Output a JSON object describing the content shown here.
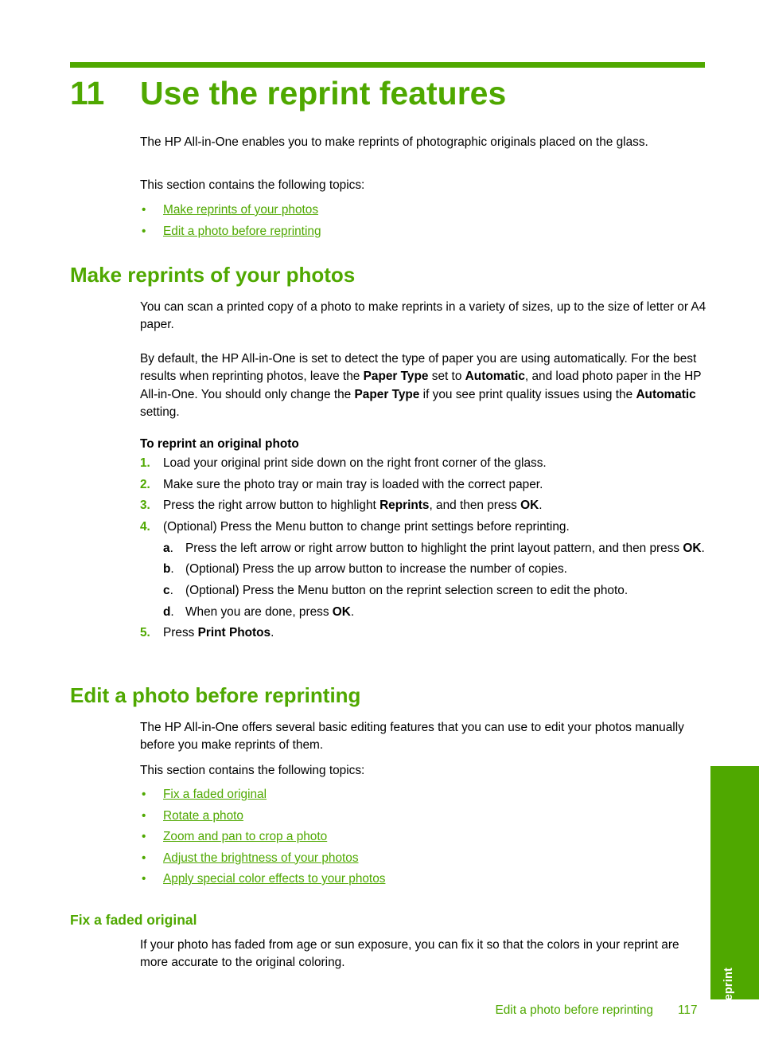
{
  "colors": {
    "accent_green": "#4FA800",
    "text_black": "#000000",
    "tab_text": "#FFFFFF"
  },
  "chapter": {
    "number": "11",
    "title": "Use the reprint features"
  },
  "intro": {
    "paragraph": "The HP All-in-One enables you to make reprints of photographic originals placed on the glass.",
    "topics_lead": "This section contains the following topics:",
    "bullet": "•",
    "topics": [
      {
        "label": "Make reprints of your photos"
      },
      {
        "label": "Edit a photo before reprinting"
      }
    ]
  },
  "section_make_reprints": {
    "heading": "Make reprints of your photos",
    "paragraph_1": "You can scan a printed copy of a photo to make reprints in a variety of sizes, up to the size of letter or A4 paper.",
    "paragraph_2_parts": [
      {
        "text": "By default, the HP All-in-One is set to detect the type of paper you are using automatically. For the best results when reprinting photos, leave the ",
        "bold": false
      },
      {
        "text": "Paper Type",
        "bold": true
      },
      {
        "text": " set to ",
        "bold": false
      },
      {
        "text": "Automatic",
        "bold": true
      },
      {
        "text": ", and load photo paper in the HP All-in-One. You should only change the ",
        "bold": false
      },
      {
        "text": "Paper Type",
        "bold": true
      },
      {
        "text": " if you see print quality issues using the ",
        "bold": false
      },
      {
        "text": "Automatic",
        "bold": true
      },
      {
        "text": " setting.",
        "bold": false
      }
    ],
    "procedure_title": "To reprint an original photo",
    "steps": [
      {
        "marker": "1.",
        "parts": [
          {
            "text": "Load your original print side down on the right front corner of the glass.",
            "bold": false
          }
        ]
      },
      {
        "marker": "2.",
        "parts": [
          {
            "text": "Make sure the photo tray or main tray is loaded with the correct paper.",
            "bold": false
          }
        ]
      },
      {
        "marker": "3.",
        "parts": [
          {
            "text": "Press the right arrow button to highlight ",
            "bold": false
          },
          {
            "text": "Reprints",
            "bold": true
          },
          {
            "text": ", and then press ",
            "bold": false
          },
          {
            "text": "OK",
            "bold": true
          },
          {
            "text": ".",
            "bold": false
          }
        ]
      },
      {
        "marker": "4.",
        "parts": [
          {
            "text": "(Optional) Press the Menu button to change print settings before reprinting.",
            "bold": false
          }
        ],
        "substeps": [
          {
            "marker": "a",
            "marker_dot": ".",
            "parts": [
              {
                "text": "Press the left arrow or right arrow button to highlight the print layout pattern, and then press ",
                "bold": false
              },
              {
                "text": "OK",
                "bold": true
              },
              {
                "text": ".",
                "bold": false
              }
            ]
          },
          {
            "marker": "b",
            "marker_dot": ".",
            "parts": [
              {
                "text": "(Optional) Press the up arrow button to increase the number of copies.",
                "bold": false
              }
            ]
          },
          {
            "marker": "c",
            "marker_dot": ".",
            "parts": [
              {
                "text": "(Optional) Press the Menu button on the reprint selection screen to edit the photo.",
                "bold": false
              }
            ]
          },
          {
            "marker": "d",
            "marker_dot": ".",
            "parts": [
              {
                "text": "When you are done, press ",
                "bold": false
              },
              {
                "text": "OK",
                "bold": true
              },
              {
                "text": ".",
                "bold": false
              }
            ]
          }
        ]
      },
      {
        "marker": "5.",
        "parts": [
          {
            "text": "Press ",
            "bold": false
          },
          {
            "text": "Print Photos",
            "bold": true
          },
          {
            "text": ".",
            "bold": false
          }
        ]
      }
    ]
  },
  "section_edit_photo": {
    "heading": "Edit a photo before reprinting",
    "paragraph": "The HP All-in-One offers several basic editing features that you can use to edit your photos manually before you make reprints of them.",
    "topics_lead": "This section contains the following topics:",
    "bullet": "•",
    "topics": [
      {
        "label": "Fix a faded original"
      },
      {
        "label": "Rotate a photo"
      },
      {
        "label": "Zoom and pan to crop a photo"
      },
      {
        "label": "Adjust the brightness of your photos"
      },
      {
        "label": "Apply special color effects to your photos"
      }
    ],
    "subsection": {
      "heading": "Fix a faded original",
      "paragraph": "If your photo has faded from age or sun exposure, you can fix it so that the colors in your reprint are more accurate to the original coloring."
    }
  },
  "side_tab": {
    "label": "Reprint"
  },
  "footer": {
    "section_name": "Edit a photo before reprinting",
    "page_number": "117"
  }
}
